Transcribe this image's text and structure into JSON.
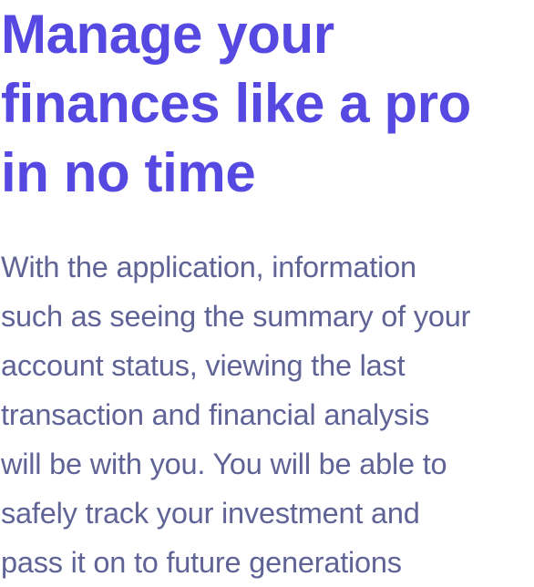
{
  "hero": {
    "headline_lines": [
      "Manage your",
      "finances like a pro",
      "in no time"
    ],
    "body_lines": [
      "With the application, information",
      "such as seeing the summary of your",
      "account status, viewing the last",
      "transaction and financial analysis",
      "will be with you. You will be able to",
      "safely track your investment and",
      "pass it on to future generations"
    ]
  },
  "colors": {
    "headline": "#5649e1",
    "body": "#5f6396",
    "background": "#ffffff"
  }
}
